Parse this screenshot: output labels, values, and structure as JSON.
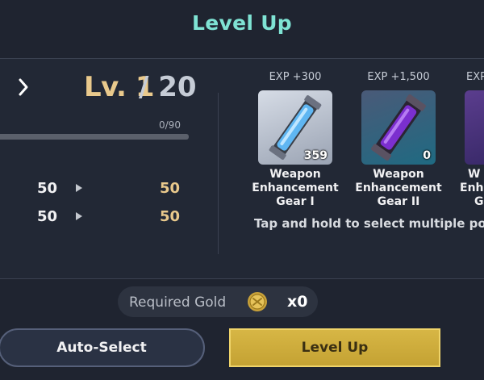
{
  "title": "Level Up",
  "level": {
    "prefix": "Lv.",
    "current": "1",
    "separator": "/",
    "max": "20",
    "exp_text": "0/90",
    "exp_fraction": 0
  },
  "stats": [
    {
      "current": "50",
      "next": "50"
    },
    {
      "current": "50",
      "next": "50"
    }
  ],
  "materials": [
    {
      "exp": "EXP +300",
      "count": "359",
      "name_lines": [
        "Weapon",
        "Enhancement",
        "Gear I"
      ],
      "color": "#4aa8e8"
    },
    {
      "exp": "EXP +1,500",
      "count": "0",
      "name_lines": [
        "Weapon",
        "Enhancement",
        "Gear II"
      ],
      "color": "#8b3fd6"
    },
    {
      "exp": "EXP",
      "count": "",
      "name_lines": [
        "W",
        "Enha",
        "G"
      ],
      "color": "#7a3fc9"
    }
  ],
  "hint": "Tap and hold to select multiple pow",
  "gold": {
    "label": "Required Gold",
    "value": "x0",
    "icon": "gold-coin-icon"
  },
  "buttons": {
    "auto_select": "Auto-Select",
    "level_up": "Level Up"
  },
  "colors": {
    "accent_title": "#7fe3d4",
    "gold_text": "#e9c98c",
    "level_button": "#d7b645"
  }
}
